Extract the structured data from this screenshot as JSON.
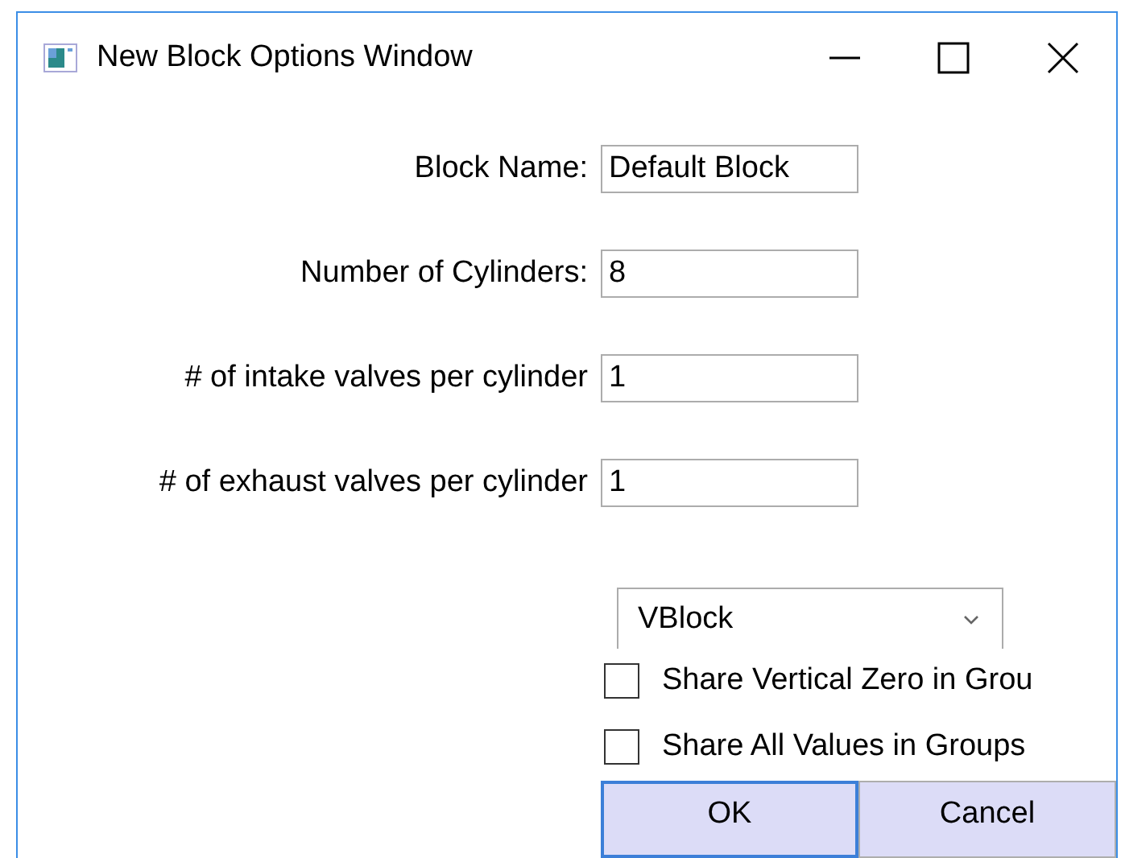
{
  "window": {
    "title": "New Block Options Window"
  },
  "fields": [
    {
      "label": "Block Name:",
      "value": "Default Block"
    },
    {
      "label": "Number of Cylinders:",
      "value": "8"
    },
    {
      "label": "# of intake valves per cylinder",
      "value": "1"
    },
    {
      "label": "# of exhaust valves per cylinder",
      "value": "1"
    }
  ],
  "dropdown": {
    "value": "VBlock"
  },
  "checkboxes": [
    {
      "label": "Share Vertical Zero in Grou",
      "checked": false
    },
    {
      "label": "Share All Values in Groups",
      "checked": false
    }
  ],
  "buttons": [
    {
      "label": "OK",
      "focused": true
    },
    {
      "label": "Cancel",
      "focused": false
    }
  ]
}
